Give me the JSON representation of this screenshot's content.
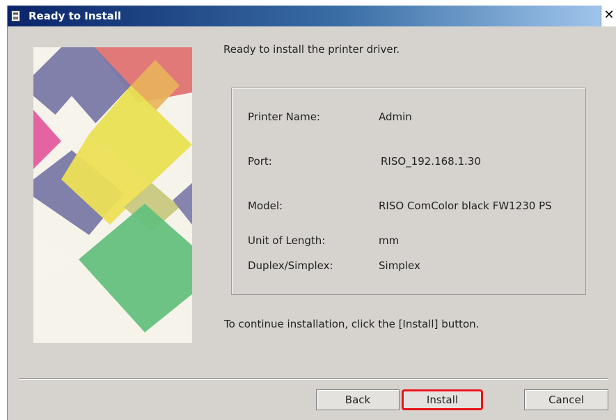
{
  "window": {
    "title": "Ready to Install",
    "close_glyph": "✕"
  },
  "content": {
    "message": "Ready to install the printer driver.",
    "info": [
      {
        "label": "Printer Name:",
        "value": "Admin"
      },
      {
        "label": "Port:",
        "value": "RISO_192.168.1.30"
      },
      {
        "label": "Model:",
        "value": "RISO ComColor black FW1230 PS"
      },
      {
        "label": "Unit of Length:",
        "value": "mm"
      },
      {
        "label": "Duplex/Simplex:",
        "value": "Simplex"
      }
    ],
    "instruction": "To continue installation, click the [Install] button."
  },
  "buttons": {
    "back": "Back",
    "install": "Install",
    "cancel": "Cancel"
  },
  "colors": {
    "install_highlight": "#e8121a",
    "title_bar": "#0a246a"
  },
  "icons": [
    "printer-app-icon",
    "close-icon"
  ]
}
